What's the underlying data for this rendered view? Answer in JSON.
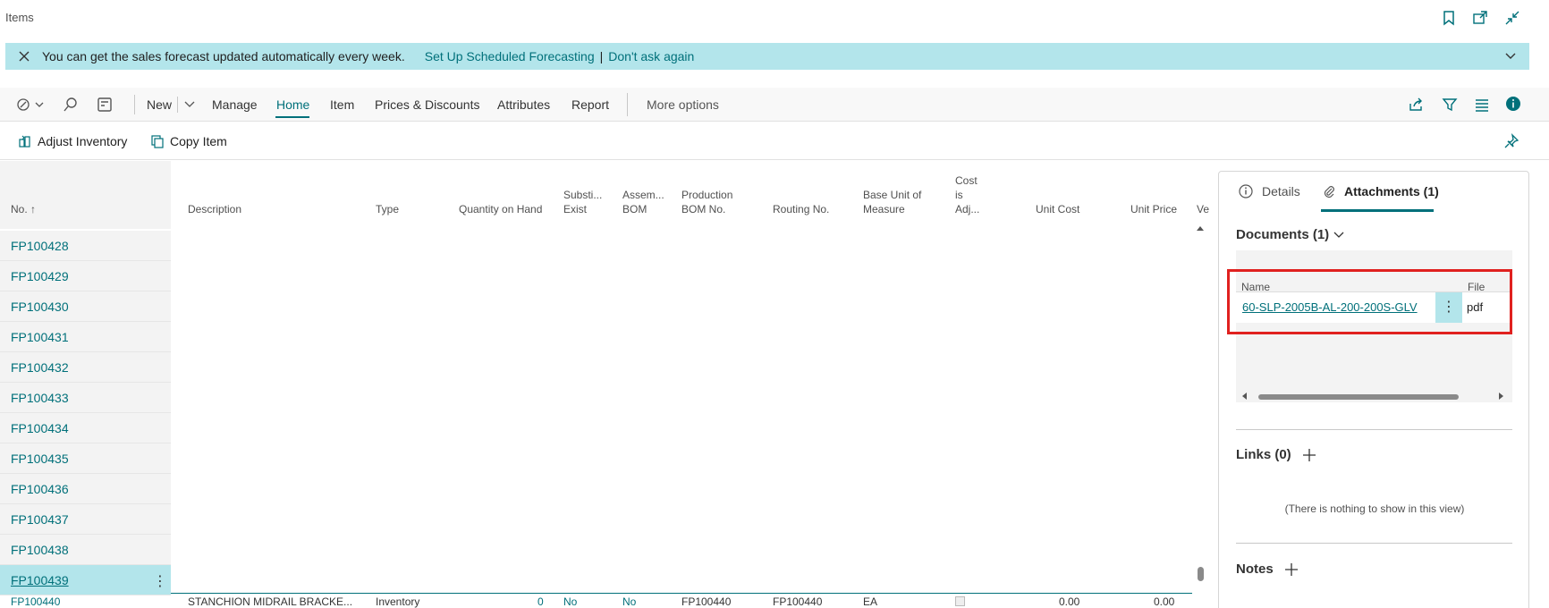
{
  "window": {
    "title": "Items"
  },
  "notification": {
    "message": "You can get the sales forecast updated automatically every week.",
    "link1": "Set Up Scheduled Forecasting",
    "separator": "|",
    "link2": "Don't ask again"
  },
  "actionbar": {
    "new_label": "New",
    "manage": "Manage",
    "home": "Home",
    "item": "Item",
    "prices": "Prices & Discounts",
    "attributes": "Attributes",
    "report": "Report",
    "more": "More options"
  },
  "toolbar": {
    "adjust": "Adjust Inventory",
    "copy": "Copy Item"
  },
  "columns": {
    "no": "No. ↑",
    "description": "Description",
    "type": "Type",
    "qty": "Quantity on Hand",
    "subst1": "Substi...",
    "subst2": "Exist",
    "assem1": "Assem...",
    "assem2": "BOM",
    "prod1": "Production",
    "prod2": "BOM No.",
    "routing": "Routing No.",
    "base1": "Base Unit of",
    "base2": "Measure",
    "cost1": "Cost",
    "cost2": "is",
    "cost3": "Adj...",
    "unit_cost": "Unit Cost",
    "unit_price": "Unit Price",
    "ve": "Ve"
  },
  "rows": [
    "FP100428",
    "FP100429",
    "FP100430",
    "FP100431",
    "FP100432",
    "FP100433",
    "FP100434",
    "FP100435",
    "FP100436",
    "FP100437",
    "FP100438",
    "FP100439"
  ],
  "selected_row": "FP100439",
  "partial_row": {
    "no": "FP100440",
    "description": "STANCHION MIDRAIL BRACKE...",
    "type": "Inventory",
    "qty": "0",
    "subst": "No",
    "assem": "No",
    "prod": "FP100440",
    "routing": "FP100440",
    "base": "EA",
    "unit_cost": "0.00",
    "unit_price": "0.00"
  },
  "factbox": {
    "tab_details": "Details",
    "tab_attachments": "Attachments (1)",
    "documents": "Documents (1)",
    "grid_name": "Name",
    "grid_ext": "File Exten",
    "doc_name": "60-SLP-2005B-AL-200-200S-GLV",
    "doc_ext": "pdf",
    "links": "Links (0)",
    "empty": "(There is nothing to show in this view)",
    "notes": "Notes"
  },
  "colors": {
    "accent": "#00707a",
    "banner": "#b3e5eb",
    "highlight": "#e0211f"
  }
}
